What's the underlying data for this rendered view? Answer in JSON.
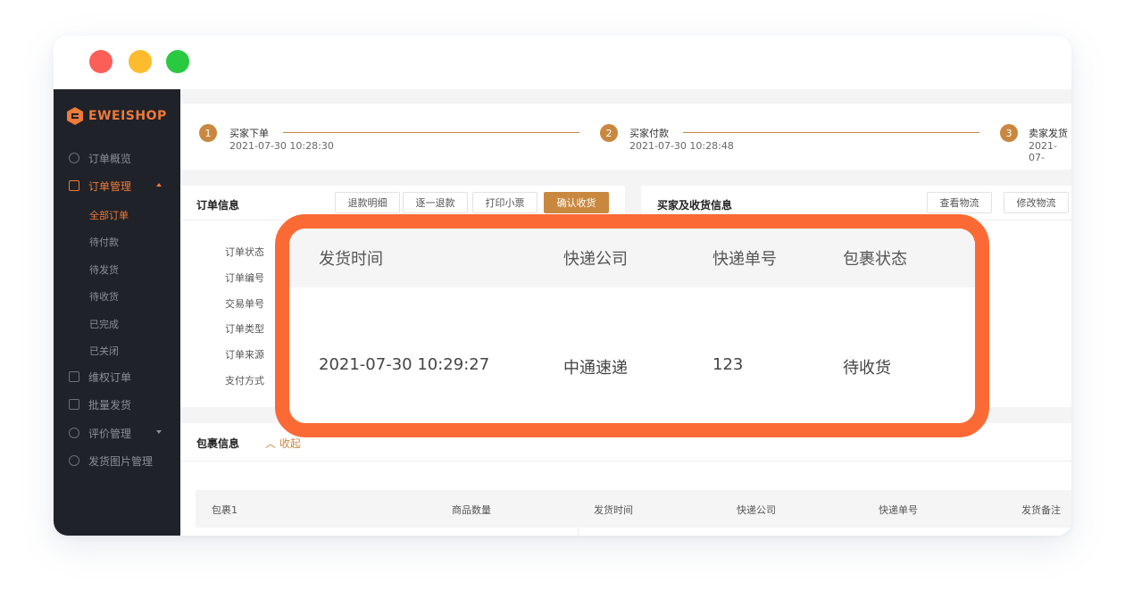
{
  "brand": {
    "name": "EWEISHOP",
    "accent": "#ef7a3a"
  },
  "sidebar": {
    "items": [
      {
        "label": "订单概览",
        "icon": "clock-icon"
      },
      {
        "label": "订单管理",
        "icon": "document-icon",
        "expanded": true,
        "active": true
      },
      {
        "label": "维权订单",
        "icon": "grid-icon"
      },
      {
        "label": "批量发货",
        "icon": "checkbox-icon"
      },
      {
        "label": "评价管理",
        "icon": "comment-icon"
      },
      {
        "label": "发货图片管理",
        "icon": "image-icon"
      }
    ],
    "sub_items": [
      {
        "label": "全部订单",
        "active": true
      },
      {
        "label": "待付款"
      },
      {
        "label": "待发货"
      },
      {
        "label": "待收货"
      },
      {
        "label": "已完成"
      },
      {
        "label": "已关闭"
      }
    ]
  },
  "steps": [
    {
      "number": "1",
      "label": "买家下单",
      "time": "2021-07-30 10:28:30"
    },
    {
      "number": "2",
      "label": "买家付款",
      "time": "2021-07-30 10:28:48"
    },
    {
      "number": "3",
      "label": "卖家发货",
      "time": "2021-07-"
    }
  ],
  "order_panel": {
    "title": "订单信息",
    "buttons": [
      "退款明细",
      "逐一退款",
      "打印小票",
      "确认收货"
    ],
    "fields": [
      "订单状态",
      "订单编号",
      "交易单号",
      "订单类型",
      "订单来源",
      "支付方式"
    ]
  },
  "buyer_panel": {
    "title": "买家及收货信息",
    "buttons": [
      "查看物流",
      "修改物流"
    ]
  },
  "package_panel": {
    "title": "包裹信息",
    "collapse_label": "收起",
    "columns": [
      "包裹1",
      "商品数量",
      "发货时间",
      "快递公司",
      "快递单号",
      "发货备注"
    ]
  },
  "callout": {
    "headers": [
      "发货时间",
      "快递公司",
      "快递单号",
      "包裹状态"
    ],
    "row": [
      "2021-07-30 10:29:27",
      "中通速递",
      "123",
      "待收货"
    ]
  }
}
